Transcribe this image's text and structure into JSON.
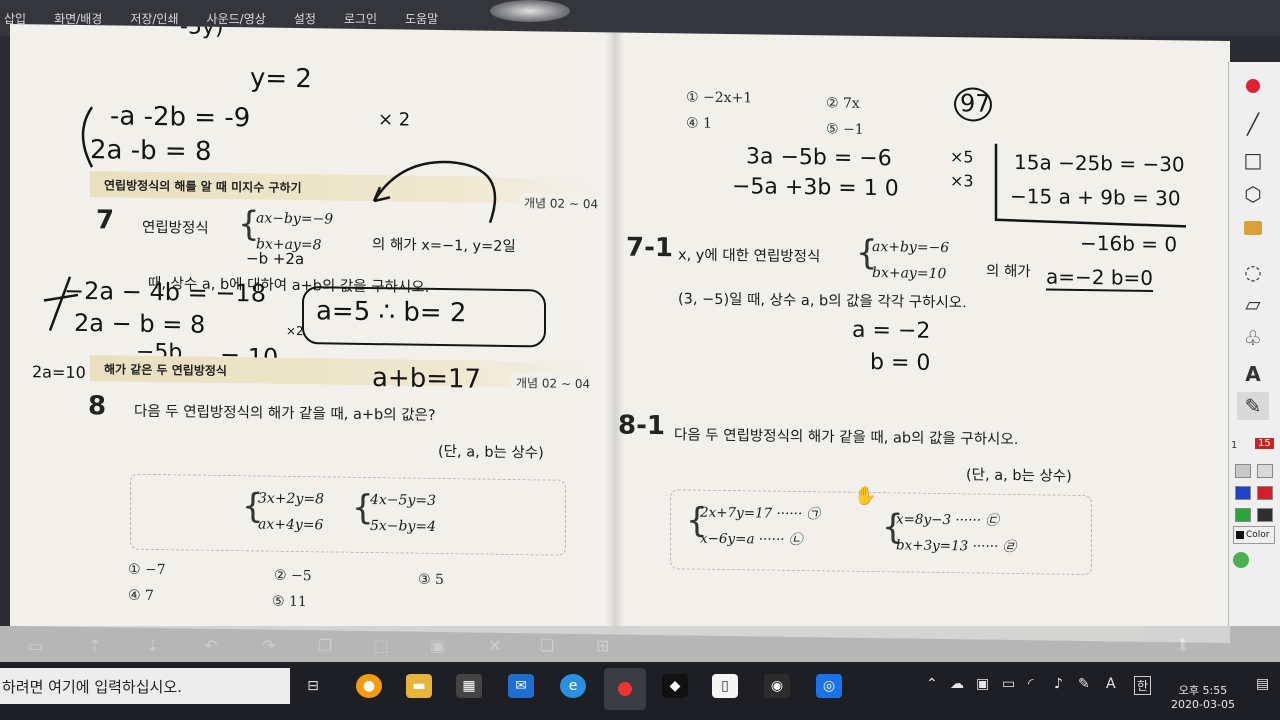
{
  "menu": [
    "삽입",
    "화면/배경",
    "저장/인쇄",
    "사운드/영상",
    "설정",
    "로그인",
    "도움말"
  ],
  "left": {
    "top_handwriting": [
      "-5y)",
      "y= 2",
      "-a -2b = -9",
      "× 2",
      "2a    -b = 8"
    ],
    "section1": {
      "title": "연립방정식의 해를 알 때 미지수 구하기",
      "tag": "개념 02 ~ 04"
    },
    "q7": {
      "number": "7",
      "text1": "연립방정식",
      "eq1": "ax−by=−9",
      "eq2": "bx+ay=8",
      "text2": "의 해가 x=−1, y=2일",
      "text3": "때, 상수 a, b에 대하여 a+b의 값을 구하시오.",
      "hand_lines": [
        "−2a − 4b = −18",
        "2a − b = 8",
        "−5b",
        "= 10",
        "a=5 ∴ b= 2",
        "2a=10",
        "a+b=17",
        "−b +2a",
        "×2"
      ]
    },
    "section2": {
      "title": "해가 같은 두 연립방정식",
      "tag": "개념 02 ~ 04"
    },
    "q8": {
      "number": "8",
      "text": "다음 두 연립방정식의 해가 같을 때, a+b의 값은?",
      "note": "(단, a, b는 상수)",
      "sysA": [
        "3x+2y=8",
        "ax+4y=6"
      ],
      "sysB": [
        "4x−5y=3",
        "5x−by=4"
      ],
      "choices": [
        "① −7",
        "② −5",
        "③ 5",
        "④ 7",
        "⑤ 11"
      ]
    }
  },
  "right": {
    "top_choices": [
      "① −2x+1",
      "② 7x",
      "④ 1",
      "⑤ −1"
    ],
    "circled": "97",
    "hand_lines": [
      "3a −5b = −6",
      "−5a +3b = 1 0",
      "×5",
      "×3",
      "15a −25b = −30",
      "−15 a + 9b = 30",
      "−16b = 0",
      "a=−2  b=0"
    ],
    "q71": {
      "number": "7-1",
      "text1": "x, y에 대한 연립방정식",
      "eq1": "ax+by=−6",
      "eq2": "bx+ay=10",
      "text2": "의 해가",
      "text3": "(3, −5)일 때, 상수 a, b의 값을 각각 구하시오.",
      "answers": [
        "a = −2",
        "b = 0"
      ]
    },
    "q81": {
      "number": "8-1",
      "text": "다음 두 연립방정식의 해가 같을 때, ab의 값을 구하시오.",
      "note": "(단, a, b는 상수)",
      "sysA": [
        "2x+7y=17  ······ ㉠",
        "x−6y=a  ······ ㉡"
      ],
      "sysB": [
        "x=8y−3  ······ ㉢",
        "bx+3y=13  ······ ㉣"
      ]
    }
  },
  "palette": {
    "page_indicator": "1",
    "page_badge": "15",
    "color_label": "Color"
  },
  "taskbar": {
    "search_placeholder": "하려면 여기에 입력하십시오.",
    "time": "오후 5:55",
    "date": "2020-03-05",
    "ime_label": "한",
    "lang_label": "A"
  },
  "colors": {
    "palette_colors": [
      "#c8c8c8",
      "#d9d9d9",
      "#2240c8",
      "#d21f2a",
      "#2aa43a",
      "#2d2d2d"
    ]
  }
}
